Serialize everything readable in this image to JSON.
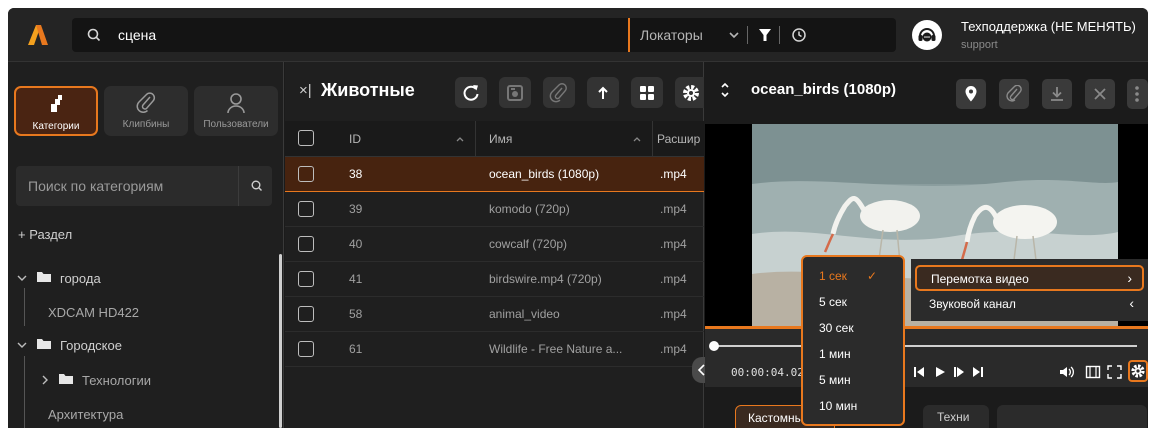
{
  "search": {
    "query": "сцена",
    "locators_label": "Локаторы"
  },
  "support": {
    "title": "Техподдержка (НЕ МЕНЯТЬ)",
    "subtitle": "support"
  },
  "colors": {
    "accent": "#e8781e",
    "background": "#1b1b1b",
    "panel": "#242424"
  },
  "left_nav": {
    "tabs": [
      {
        "label": "Категории",
        "icon": "categories-icon",
        "active": true
      },
      {
        "label": "Клипбины",
        "icon": "paperclip-icon",
        "active": false
      },
      {
        "label": "Пользователи",
        "icon": "user-icon",
        "active": false
      }
    ],
    "search_placeholder": "Поиск по категориям",
    "add_section": "+ Раздел",
    "tree": [
      {
        "label": "города",
        "type": "folder",
        "expanded": true
      },
      {
        "label": "XDCAM HD422",
        "type": "item"
      },
      {
        "label": "Городское",
        "type": "folder",
        "expanded": true
      },
      {
        "label": "Технологии",
        "type": "folder",
        "expanded": false
      },
      {
        "label": "Архитектура",
        "type": "item"
      }
    ]
  },
  "bin": {
    "close_glyph": "×|",
    "title": "Животные",
    "toolbar_icons": [
      "refresh-icon",
      "camera-icon",
      "paperclip-icon",
      "upload-icon",
      "grid-icon",
      "gear-icon"
    ],
    "columns": {
      "id": "ID",
      "name": "Имя",
      "ext": "Расшир"
    },
    "rows": [
      {
        "id": "38",
        "name": "ocean_birds (1080p)",
        "ext": ".mp4",
        "selected": true
      },
      {
        "id": "39",
        "name": "komodo (720p)",
        "ext": ".mp4",
        "selected": false
      },
      {
        "id": "40",
        "name": "cowcalf (720p)",
        "ext": ".mp4",
        "selected": false
      },
      {
        "id": "41",
        "name": "birdswire.mp4 (720p)",
        "ext": ".mp4",
        "selected": false
      },
      {
        "id": "58",
        "name": "animal_video",
        "ext": ".mp4",
        "selected": false
      },
      {
        "id": "61",
        "name": "Wildlife - Free Nature a...",
        "ext": ".mp4",
        "selected": false
      }
    ]
  },
  "player": {
    "title": "ocean_birds (1080p)",
    "timecode": "00:00:04.026",
    "header_icons": [
      "location-pin-icon",
      "paperclip-icon",
      "download-icon",
      "close-icon",
      "more-vertical-icon"
    ],
    "bottom_tabs": [
      "Кастомные",
      "Техни"
    ]
  },
  "speed_menu": {
    "items": [
      "1 сек",
      "5 сек",
      "30 сек",
      "1 мин",
      "5 мин",
      "10 мин"
    ],
    "selected": "1 сек",
    "check_glyph": "✓"
  },
  "settings_menu": {
    "items": [
      {
        "label": "Перемотка видео",
        "arrow": "›",
        "active": true
      },
      {
        "label": "Звуковой канал",
        "arrow": "‹",
        "active": false
      }
    ]
  }
}
